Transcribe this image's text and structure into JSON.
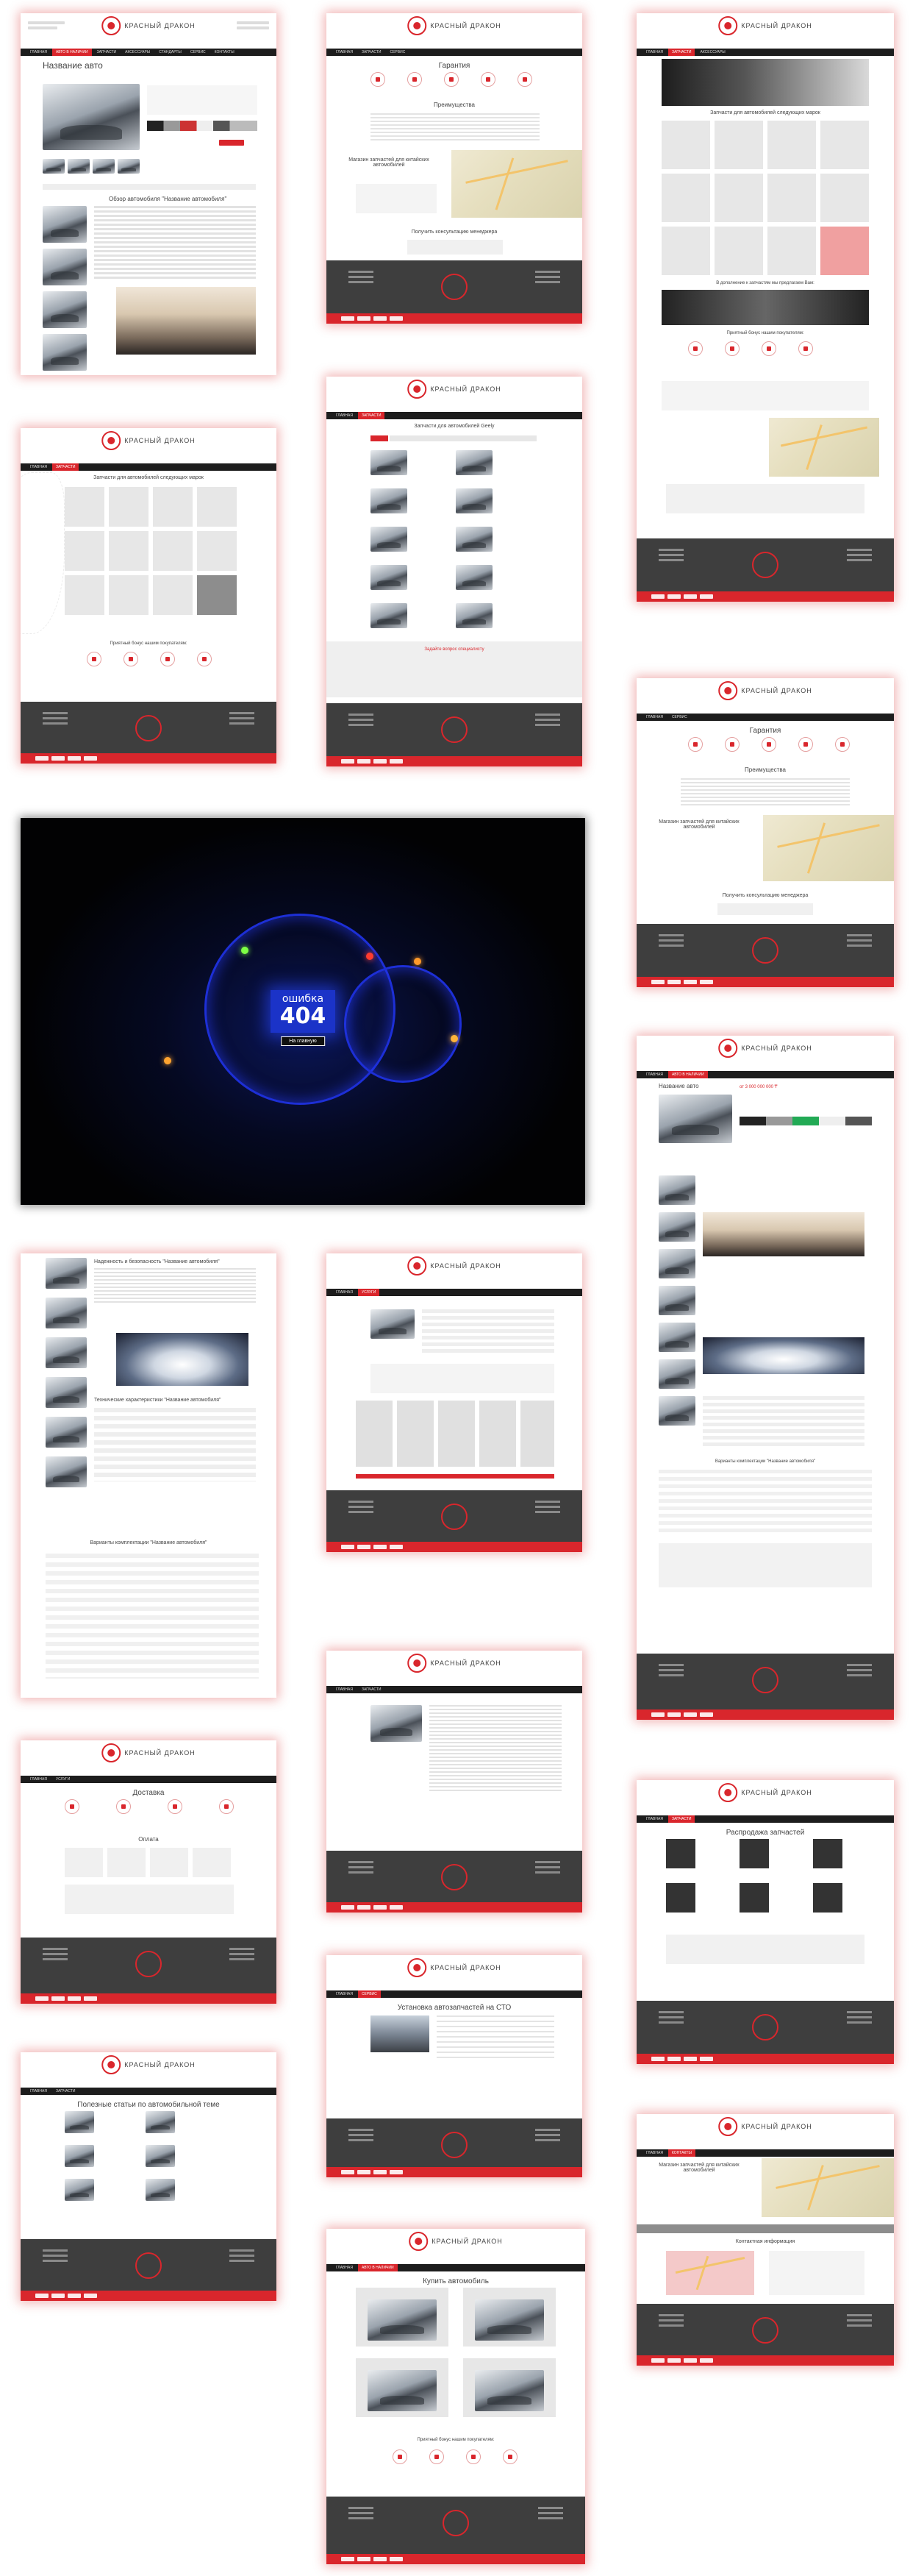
{
  "brand": {
    "name": "КРАСНЫЙ ДРАКОН",
    "accent": "#d9262c",
    "dark": "#3e3e3e"
  },
  "nav": [
    "ГЛАВНАЯ",
    "АВТО В НАЛИЧИИ",
    "ЗАПЧАСТИ",
    "АКСЕССУАРЫ",
    "СТАНДАРТЫ",
    "СЕРВИС",
    "УСЛУГИ",
    "КОНТАКТЫ"
  ],
  "pages": {
    "car": {
      "title": "Название авто",
      "price": "от 3 000 000 000 ₸",
      "review": "Обзор автомобиля \"Название автомобиля\"",
      "specs": "Технические характеристики \"Название автомобиля\"",
      "trim": "Варианты комплектации \"Название автомобиля\"",
      "reliability": "Надежность и безопасность \"Название автомобиля\""
    },
    "advantages": {
      "title": "Гарантия",
      "subtitle": "Преимущества",
      "consult": "Получить консультацию менеджера",
      "parts_title": "Магазин запчастей для китайских автомобилей"
    },
    "parts": {
      "title": "Запчасти для автомобилей следующих марок",
      "extra": "В дополнение к запчастям мы предлагаем Вам:",
      "bonus": "Приятный бонус нашим покупателям:"
    },
    "catalog": {
      "title": "Запчасти для автомобилей Geely",
      "subtitle": "Задайте вопрос специалисту"
    },
    "error": {
      "label": "ошибка",
      "code": "404",
      "button": "На главную"
    },
    "delivery": {
      "title": "Доставка",
      "payment": "Оплата"
    },
    "service": {
      "title": "Установка автозапчастей на СТО"
    },
    "news": {
      "title": "Полезные статьи по автомобильной теме"
    },
    "stock": {
      "title": "Распродажа запчастей"
    },
    "contacts": {
      "title": "Контактная информация"
    },
    "autos": {
      "title": "Купить автомобиль"
    }
  }
}
